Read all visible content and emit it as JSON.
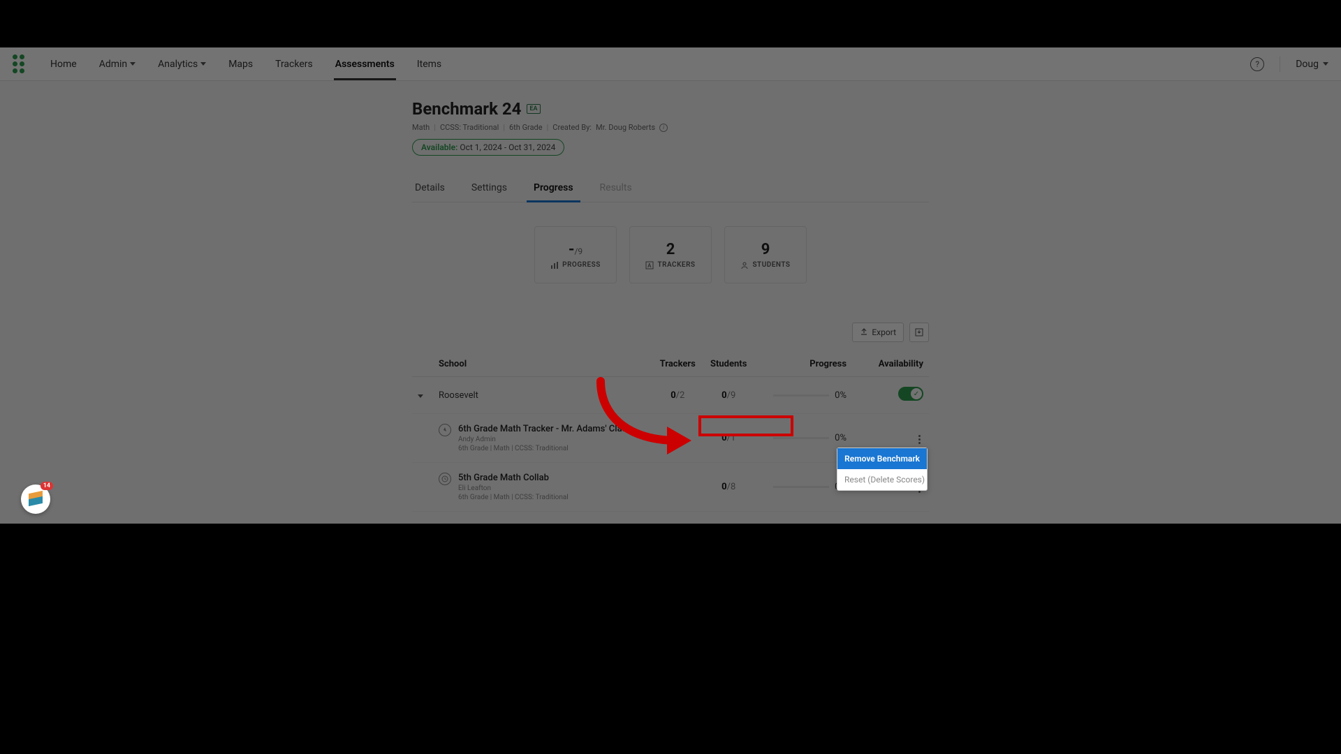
{
  "nav": {
    "items": [
      "Home",
      "Admin",
      "Analytics",
      "Maps",
      "Trackers",
      "Assessments",
      "Items"
    ],
    "active": "Assessments",
    "user": "Doug"
  },
  "header": {
    "title": "Benchmark 24",
    "badge": "EA",
    "meta": {
      "subject": "Math",
      "standard": "CCSS: Traditional",
      "grade": "6th Grade",
      "created_by_label": "Created By:",
      "created_by": "Mr. Doug Roberts"
    },
    "availability": {
      "label": "Available:",
      "dates": "Oct 1, 2024 - Oct 31, 2024"
    }
  },
  "tabs": [
    "Details",
    "Settings",
    "Progress",
    "Results"
  ],
  "tabs_active": "Progress",
  "tabs_disabled": [
    "Results"
  ],
  "stats": {
    "progress": {
      "value": "-",
      "denom": "/9",
      "label": "PROGRESS"
    },
    "trackers": {
      "value": "2",
      "label": "TRACKERS"
    },
    "students": {
      "value": "9",
      "label": "STUDENTS"
    }
  },
  "toolbar": {
    "export": "Export"
  },
  "table": {
    "headers": {
      "school": "School",
      "trackers": "Trackers",
      "students": "Students",
      "progress": "Progress",
      "availability": "Availability"
    },
    "school_row": {
      "name": "Roosevelt",
      "trackers": {
        "num": "0",
        "den": "/2"
      },
      "students": {
        "num": "0",
        "den": "/9"
      },
      "progress": "0%",
      "toggle_on": true
    },
    "trackers": [
      {
        "name": "6th Grade Math Tracker - Mr. Adams' Class",
        "owner": "Andy Admin",
        "meta": "6th Grade  |  Math  |  CCSS: Traditional",
        "students": {
          "num": "0",
          "den": "/1"
        },
        "progress": "0%"
      },
      {
        "name": "5th Grade Math Collab",
        "owner": "Eli Leafton",
        "meta": "6th Grade  |  Math  |  CCSS: Traditional",
        "students": {
          "num": "0",
          "den": "/8"
        },
        "progress": "0%"
      }
    ]
  },
  "menu": {
    "remove": "Remove Benchmark",
    "reset": "Reset (Delete Scores)"
  },
  "widget": {
    "badge": "14"
  }
}
